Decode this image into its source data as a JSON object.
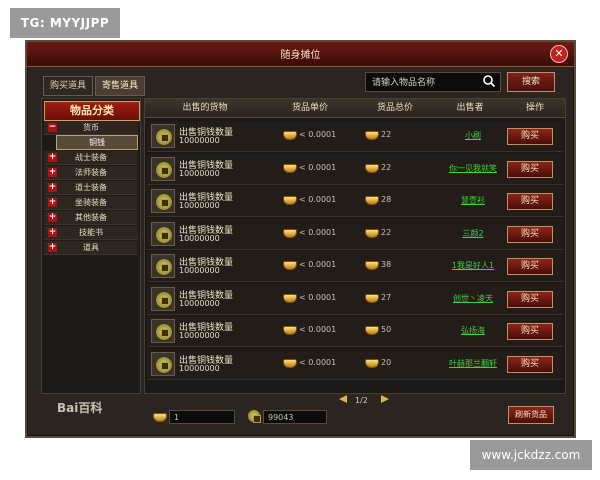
{
  "watermarks": {
    "top_left": "TG: MYYJJPP",
    "bottom_right": "www.jckdzz.com"
  },
  "window": {
    "title": "随身摊位"
  },
  "tabs": [
    "购买道具",
    "寄售道具"
  ],
  "search": {
    "placeholder": "请输入物品名称",
    "button": "搜索"
  },
  "sidebar": {
    "title": "物品分类",
    "items": [
      {
        "label": "货币",
        "toggle": "−"
      },
      {
        "label": "铜钱",
        "toggle": ""
      },
      {
        "label": "战士装备",
        "toggle": "+"
      },
      {
        "label": "法师装备",
        "toggle": "+"
      },
      {
        "label": "道士装备",
        "toggle": "+"
      },
      {
        "label": "坐骑装备",
        "toggle": "+"
      },
      {
        "label": "其他装备",
        "toggle": "+"
      },
      {
        "label": "技能书",
        "toggle": "+"
      },
      {
        "label": "道具",
        "toggle": "+"
      }
    ]
  },
  "logo": "Bai百科",
  "table": {
    "headers": [
      "出售的货物",
      "货品单价",
      "货品总价",
      "出售者",
      "操作"
    ],
    "rows": [
      {
        "name": "出售铜钱数量",
        "qty": "10000000",
        "unit_price": "< 0.0001",
        "total": "22",
        "seller": "小刷",
        "action": "购买"
      },
      {
        "name": "出售铜钱数量",
        "qty": "10000000",
        "unit_price": "< 0.0001",
        "total": "22",
        "seller": "你一见我就笑",
        "action": "购买"
      },
      {
        "name": "出售铜钱数量",
        "qty": "10000000",
        "unit_price": "< 0.0001",
        "total": "28",
        "seller": "慧壹衫",
        "action": "购买"
      },
      {
        "name": "出售铜钱数量",
        "qty": "10000000",
        "unit_price": "< 0.0001",
        "total": "22",
        "seller": "三颜2",
        "action": "购买"
      },
      {
        "name": "出售铜钱数量",
        "qty": "10000000",
        "unit_price": "< 0.0001",
        "total": "38",
        "seller": "1我是好人1",
        "action": "购买"
      },
      {
        "name": "出售铜钱数量",
        "qty": "10000000",
        "unit_price": "< 0.0001",
        "total": "27",
        "seller": "创世丶凌天",
        "action": "购买"
      },
      {
        "name": "出售铜钱数量",
        "qty": "10000000",
        "unit_price": "< 0.0001",
        "total": "50",
        "seller": "弘扬海",
        "action": "购买"
      },
      {
        "name": "出售铜钱数量",
        "qty": "10000000",
        "unit_price": "< 0.0001",
        "total": "20",
        "seller": "叶赫那兰翻轩",
        "action": "购买"
      }
    ]
  },
  "pager": "1/2",
  "bottom": {
    "ingot_value": "1",
    "coin_value": "99043",
    "refresh": "刷新货品"
  }
}
